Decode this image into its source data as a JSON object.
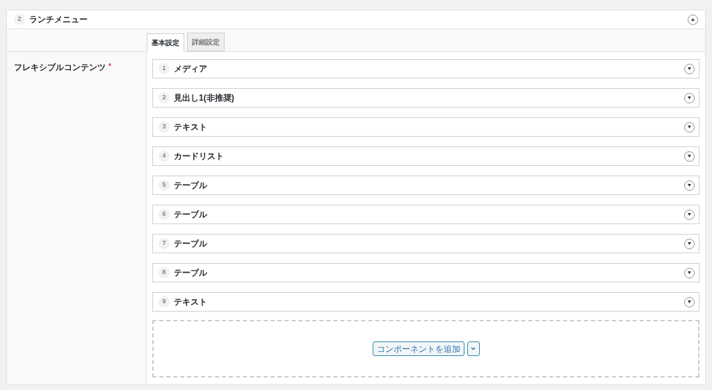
{
  "layout": {
    "number": "2",
    "title": "ランチメニュー",
    "expanded": true
  },
  "tabs": [
    {
      "label": "基本設定",
      "selected": true
    },
    {
      "label": "詳細設定",
      "selected": false
    }
  ],
  "field": {
    "label": "フレキシブルコンテンツ",
    "required_mark": "*"
  },
  "components": [
    {
      "number": "1",
      "title": "メディア",
      "expanded": false
    },
    {
      "number": "2",
      "title": "見出し1(非推奨)",
      "expanded": false
    },
    {
      "number": "3",
      "title": "テキスト",
      "expanded": false
    },
    {
      "number": "4",
      "title": "カードリスト",
      "expanded": false
    },
    {
      "number": "5",
      "title": "テーブル",
      "expanded": false
    },
    {
      "number": "6",
      "title": "テーブル",
      "expanded": false
    },
    {
      "number": "7",
      "title": "テーブル",
      "expanded": false
    },
    {
      "number": "8",
      "title": "テーブル",
      "expanded": false
    },
    {
      "number": "9",
      "title": "テキスト",
      "expanded": false
    }
  ],
  "add_button": {
    "label": "コンポーネントを追加"
  }
}
